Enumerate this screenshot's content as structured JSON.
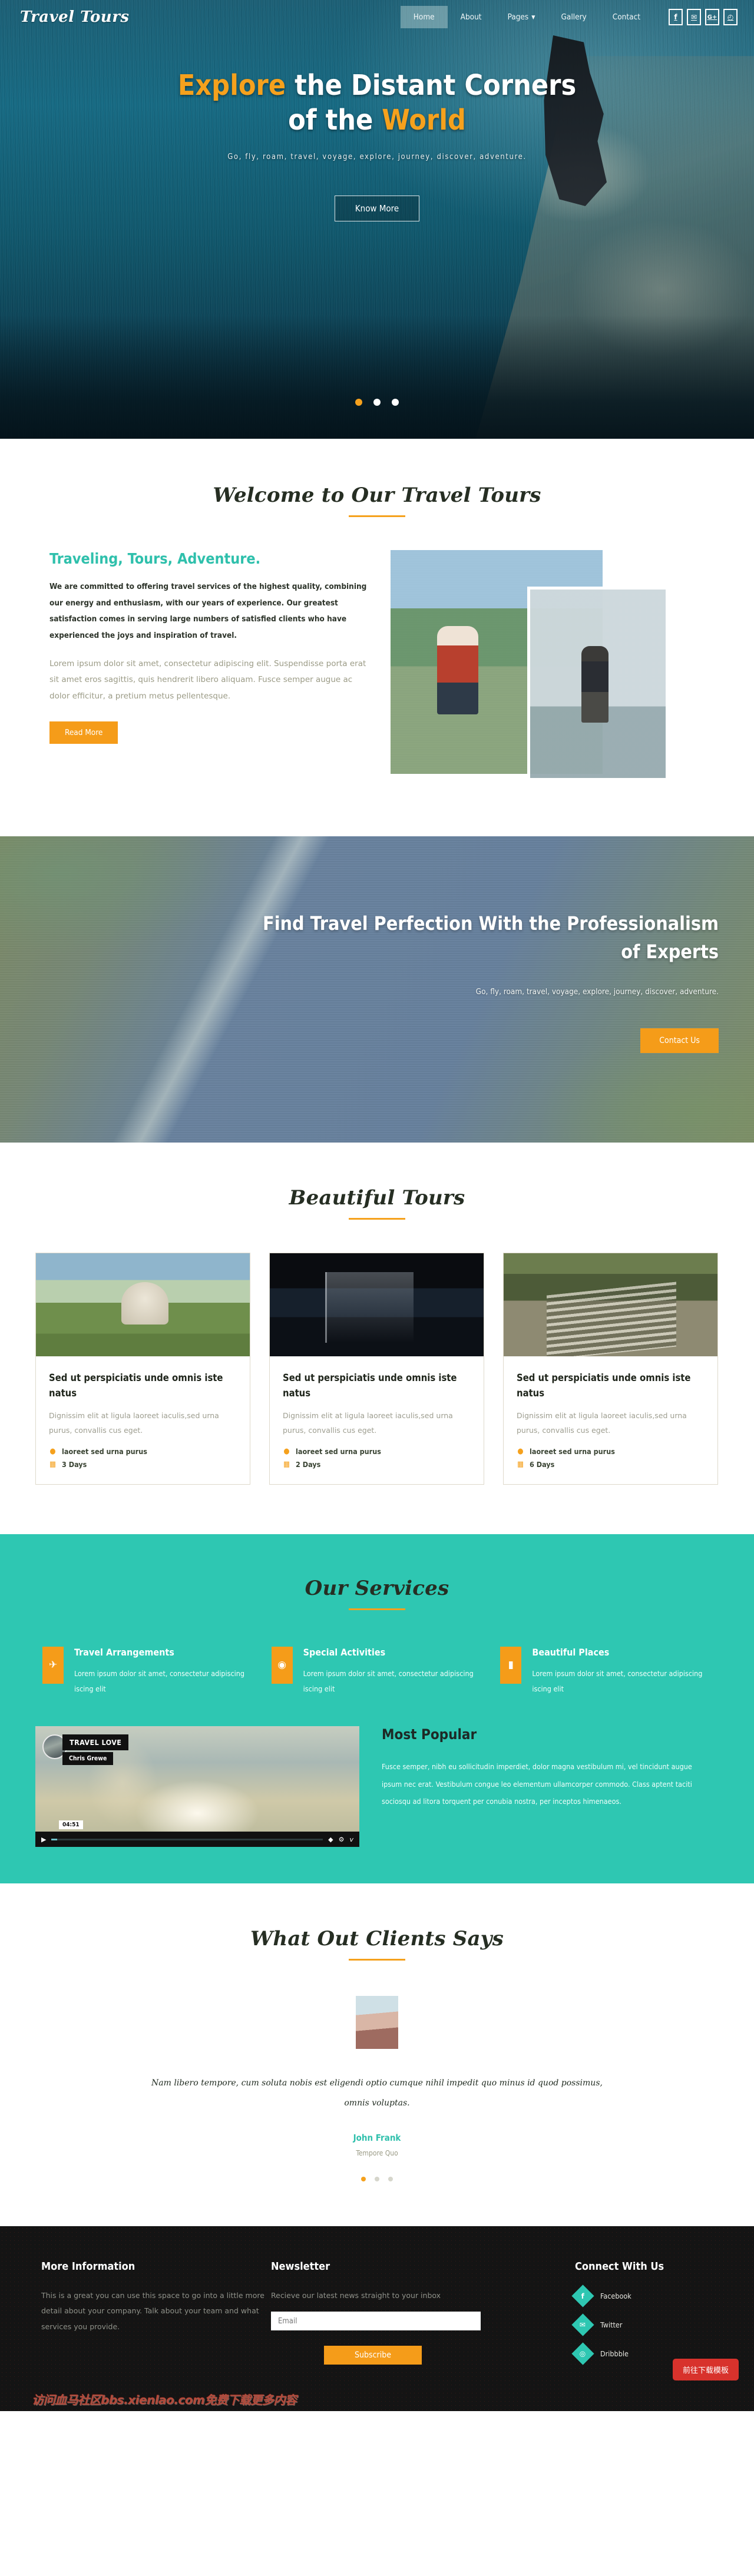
{
  "site": {
    "logo": "Travel Tours"
  },
  "nav": {
    "items": [
      {
        "label": "Home",
        "active": true
      },
      {
        "label": "About",
        "active": false
      },
      {
        "label": "Pages",
        "active": false,
        "caret": true
      },
      {
        "label": "Gallery",
        "active": false
      },
      {
        "label": "Contact",
        "active": false
      }
    ],
    "socials": [
      {
        "name": "facebook-icon",
        "glyph": "f"
      },
      {
        "name": "twitter-icon",
        "glyph": "✉"
      },
      {
        "name": "google-plus-icon",
        "glyph": "G+"
      },
      {
        "name": "rss-icon",
        "glyph": "◴"
      }
    ]
  },
  "hero": {
    "title_part1": "Explore",
    "title_part2": " the Distant Corners",
    "title_part3": "of the ",
    "title_part4": "World",
    "subtitle": "Go, fly, roam, travel, voyage, explore, journey, discover, adventure.",
    "button": "Know More",
    "slides": 3,
    "active_slide": 1
  },
  "welcome": {
    "title": "Welcome to Our Travel Tours",
    "subtitle": "Traveling, Tours, Adventure.",
    "paragraph_bold": "We are committed to offering travel services of the highest quality, combining our energy and enthusiasm, with our years of experience. Our greatest satisfaction comes in serving large numbers of satisfied clients who have experienced the joys and inspiration of travel.",
    "paragraph_muted": "Lorem ipsum dolor sit amet, consectetur adipiscing elit. Suspendisse porta erat sit amet eros sagittis, quis hendrerit libero aliquam. Fusce semper augue ac dolor efficitur, a pretium metus pellentesque.",
    "button": "Read More"
  },
  "parallax": {
    "title_line1": "Find Travel Perfection With the Professionalism",
    "title_line2": "of Experts",
    "subtitle": "Go, fly, roam, travel, voyage, explore, journey, discover, adventure.",
    "button": "Contact Us"
  },
  "tours": {
    "title": "Beautiful Tours",
    "cards": [
      {
        "title": "Sed ut perspiciatis unde omnis iste natus",
        "text": "Dignissim elit at ligula laoreet iaculis,sed urna purus, convallis cus eget.",
        "location": "laoreet sed urna purus",
        "duration": "3 Days"
      },
      {
        "title": "Sed ut perspiciatis unde omnis iste natus",
        "text": "Dignissim elit at ligula laoreet iaculis,sed urna purus, convallis cus eget.",
        "location": "laoreet sed urna purus",
        "duration": "2 Days"
      },
      {
        "title": "Sed ut perspiciatis unde omnis iste natus",
        "text": "Dignissim elit at ligula laoreet iaculis,sed urna purus, convallis cus eget.",
        "location": "laoreet sed urna purus",
        "duration": "6 Days"
      }
    ]
  },
  "services": {
    "title": "Our Services",
    "items": [
      {
        "icon": "airplane-icon",
        "glyph": "✈",
        "title": "Travel Arrangements",
        "text": "Lorem ipsum dolor sit amet, consectetur adipiscing iscing elit"
      },
      {
        "icon": "globe-icon",
        "glyph": "◉",
        "title": "Special Activities",
        "text": "Lorem ipsum dolor sit amet, consectetur adipiscing iscing elit"
      },
      {
        "icon": "suitcase-icon",
        "glyph": "▮",
        "title": "Beautiful Places",
        "text": "Lorem ipsum dolor sit amet, consectetur adipiscing iscing elit"
      }
    ]
  },
  "popular": {
    "video": {
      "badge": "TRAVEL LOVE",
      "user": "Chris Grewe",
      "time": "04:51",
      "play_glyph": "▶",
      "volume_glyph": "◆",
      "settings_glyph": "⚙",
      "brand_glyph": "v"
    },
    "title": "Most Popular",
    "text": "Fusce semper, nibh eu sollicitudin imperdiet, dolor magna vestibulum mi, vel tincidunt augue ipsum nec erat. Vestibulum congue leo elementum ullamcorper commodo. Class aptent taciti sociosqu ad litora torquent per conubia nostra, per inceptos himenaeos."
  },
  "testimonials": {
    "title": "What Out Clients Says",
    "quote": "Nam libero tempore, cum soluta nobis est eligendi optio cumque nihil impedit quo minus id quod possimus, omnis voluptas.",
    "name": "John Frank",
    "role": "Tempore Quo",
    "slides": 3,
    "active_slide": 1
  },
  "footer": {
    "more_info": {
      "title": "More Information",
      "text": "This is a great you can use this space to go into a little more detail about your company. Talk about your team and what services you provide."
    },
    "newsletter": {
      "title": "Newsletter",
      "text": "Recieve our latest news straight to your inbox",
      "placeholder": "Email",
      "value": "",
      "button": "Subscribe"
    },
    "connect": {
      "title": "Connect With Us",
      "links": [
        {
          "icon": "facebook-icon",
          "glyph": "f",
          "label": "Facebook"
        },
        {
          "icon": "twitter-icon",
          "glyph": "✉",
          "label": "Twitter"
        },
        {
          "icon": "dribbble-icon",
          "glyph": "◎",
          "label": "Dribbble"
        }
      ]
    },
    "download_button": "前往下载模板",
    "watermark": "访问血马社区bbs.xienlao.com免费下载更多内容"
  },
  "colors": {
    "accent_orange": "#f59c19",
    "accent_teal": "#2ec7b2",
    "dark": "#141414",
    "red": "#d8322c"
  }
}
